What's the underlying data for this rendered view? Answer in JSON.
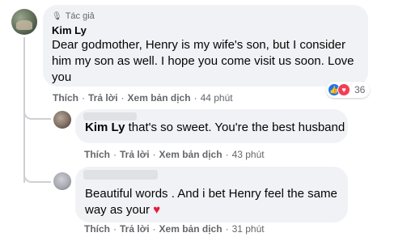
{
  "main_comment": {
    "badge": "Tác giả",
    "author": "Kim Ly",
    "text": "Dear godmother, Henry is my wife's son, but I consider him my son as well. I hope you come visit us soon. Love you",
    "actions": {
      "like": "Thích",
      "reply": "Trả lời",
      "translate": "Xem bản dịch",
      "time": "44 phút"
    },
    "reactions": {
      "count": "36",
      "icons": [
        "like-icon",
        "love-icon"
      ]
    }
  },
  "replies": [
    {
      "mention": "Kim Ly",
      "text": " that's so sweet. You're the best husband",
      "actions": {
        "like": "Thích",
        "reply": "Trả lời",
        "translate": "Xem bản dịch",
        "time": "43 phút"
      }
    },
    {
      "text": "Beautiful words . And i bet Henry feel the same way as your",
      "emoji": "heart-emoji",
      "actions": {
        "like": "Thích",
        "reply": "Trả lời",
        "translate": "Xem bản dịch",
        "time": "31 phút"
      }
    }
  ],
  "colors": {
    "bubble": "#f0f2f5",
    "secondary_text": "#65676b",
    "like_blue": "#1877f2",
    "love_red": "#f33e58"
  }
}
